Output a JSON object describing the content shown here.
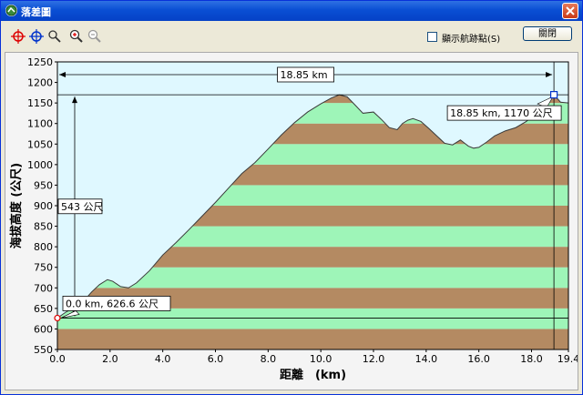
{
  "window": {
    "title": "落差圖",
    "close_label": "✕"
  },
  "toolbar": {
    "tools": [
      {
        "name": "crosshair-red-icon"
      },
      {
        "name": "crosshair-blue-icon"
      },
      {
        "name": "pan-icon"
      },
      {
        "name": "zoom-in-icon"
      },
      {
        "name": "zoom-out-icon"
      }
    ],
    "show_waypoints_label": "顯示航跡點(S)",
    "show_waypoints_checked": false,
    "close_button_label": "關閉"
  },
  "chart_data": {
    "type": "area",
    "xlabel": "距離　(km)",
    "ylabel": "海拔高度 (公尺)",
    "xlim": [
      0.0,
      19.4
    ],
    "ylim": [
      550,
      1250
    ],
    "x_ticks": [
      0.0,
      2.0,
      4.0,
      6.0,
      8.0,
      10.0,
      12.0,
      14.0,
      16.0,
      18.0,
      19.4
    ],
    "x_tick_labels": [
      "0.0",
      "2.0",
      "4.0",
      "6.0",
      "8.0",
      "10.0",
      "12.0",
      "14.0",
      "16.0",
      "18.0",
      "19.4"
    ],
    "y_ticks": [
      550,
      600,
      650,
      700,
      750,
      800,
      850,
      900,
      950,
      1000,
      1050,
      1100,
      1150,
      1200,
      1250
    ],
    "band_colors": [
      "#b48a62",
      "#9ef5b8"
    ],
    "background_color": "#dff8ff",
    "profile": {
      "x": [
        0.0,
        0.3,
        0.7,
        1.0,
        1.3,
        1.6,
        1.9,
        2.1,
        2.4,
        2.7,
        3.0,
        3.5,
        4.0,
        4.5,
        5.0,
        5.5,
        6.0,
        6.5,
        7.0,
        7.5,
        8.0,
        8.5,
        9.0,
        9.5,
        10.0,
        10.4,
        10.7,
        11.0,
        11.3,
        11.6,
        12.0,
        12.3,
        12.6,
        12.9,
        13.1,
        13.3,
        13.5,
        13.8,
        14.1,
        14.4,
        14.7,
        15.0,
        15.3,
        15.6,
        15.8,
        16.0,
        16.3,
        16.6,
        17.0,
        17.4,
        17.8,
        18.2,
        18.5,
        18.85,
        19.1,
        19.4
      ],
      "y": [
        626.6,
        640,
        655,
        668,
        690,
        708,
        720,
        716,
        703,
        700,
        712,
        742,
        780,
        810,
        842,
        875,
        908,
        943,
        978,
        1005,
        1038,
        1072,
        1102,
        1128,
        1148,
        1162,
        1170,
        1165,
        1145,
        1125,
        1128,
        1110,
        1090,
        1085,
        1100,
        1108,
        1112,
        1105,
        1088,
        1070,
        1052,
        1048,
        1060,
        1045,
        1040,
        1042,
        1055,
        1070,
        1082,
        1090,
        1105,
        1128,
        1150,
        1170,
        1152,
        1150
      ]
    },
    "annotations": {
      "distance_label": "18.85 km",
      "height_diff_label": "543 公尺",
      "start_label": "0.0 km, 626.6 公尺",
      "end_label": "18.85 km, 1170 公尺",
      "start_point": {
        "x": 0.0,
        "y": 626.6
      },
      "end_point": {
        "x": 18.85,
        "y": 1170
      },
      "top_reference_y": 1170,
      "bottom_reference_y": 626.6
    }
  }
}
